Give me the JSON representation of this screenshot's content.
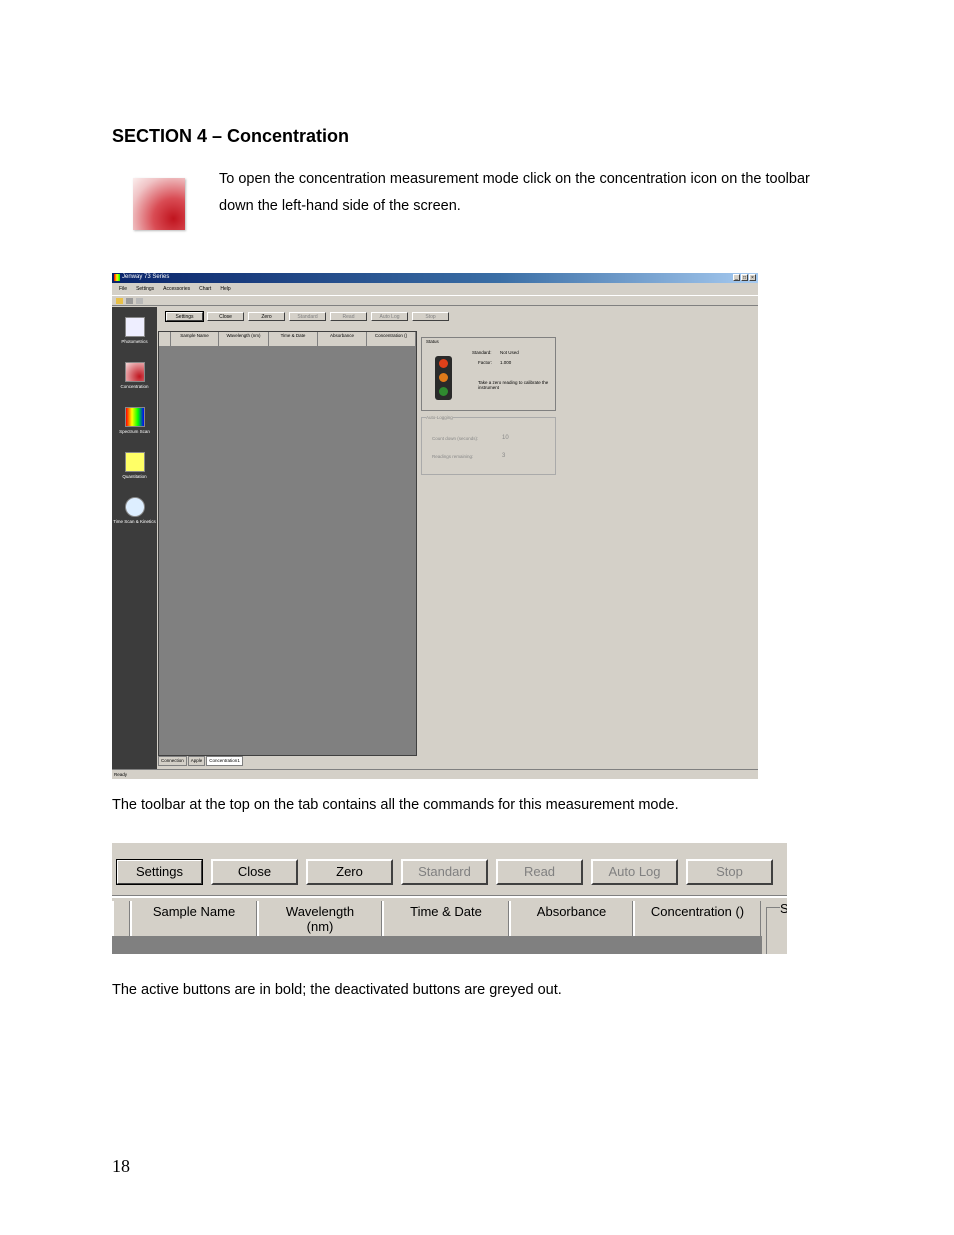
{
  "section_title": "SECTION 4 – Concentration",
  "intro_text": "To open the concentration measurement mode click on the concentration icon on the toolbar down the left-hand side of the screen.",
  "toolbar_caption": "The toolbar at the top on the tab contains all the commands for this measurement mode.",
  "active_caption": "The active buttons are in bold; the deactivated buttons are greyed out.",
  "page_number": "18",
  "app": {
    "window_title": "Jenway 73 Series",
    "menu": [
      "File",
      "Settings",
      "Accessories",
      "Chart",
      "Help"
    ],
    "window_buttons": [
      "_",
      "□",
      "×"
    ],
    "sidebar": [
      {
        "label": "Photometrics",
        "icon": "clipboard-icon"
      },
      {
        "label": "Concentration",
        "icon": "concentration-icon"
      },
      {
        "label": "Spectrum Scan",
        "icon": "spectrum-icon"
      },
      {
        "label": "Quantitation",
        "icon": "flask-icon"
      },
      {
        "label": "Time Scan & Kinetics",
        "icon": "stopwatch-icon"
      }
    ],
    "toolbar": [
      "Settings",
      "Close",
      "Zero",
      "Standard",
      "Read",
      "Auto Log",
      "Stop"
    ],
    "columns": [
      "Sample Name",
      "Wavelength (nm)",
      "Time & Date",
      "Absorbance",
      "Concentration ()"
    ],
    "status": {
      "label": "Status",
      "standard_label": "Standard:",
      "standard_value": "Not Used",
      "factor_label": "Factor:",
      "factor_value": "1.000",
      "message": "Take a zero reading to calibrate the instrument"
    },
    "autolog": {
      "label": "Auto-Logging",
      "countdown_label": "Count down (seconds):",
      "countdown_value": "10",
      "readings_label": "Readings remaining:",
      "readings_value": "3"
    },
    "tabs": [
      "Connection",
      "Apple",
      "Concentration1"
    ],
    "status_bar": "Ready"
  },
  "zoom": {
    "buttons": [
      {
        "label": "Settings",
        "state": "active"
      },
      {
        "label": "Close",
        "state": "enabled"
      },
      {
        "label": "Zero",
        "state": "enabled"
      },
      {
        "label": "Standard",
        "state": "disabled"
      },
      {
        "label": "Read",
        "state": "disabled"
      },
      {
        "label": "Auto Log",
        "state": "disabled"
      },
      {
        "label": "Stop",
        "state": "disabled"
      }
    ],
    "columns": [
      "Sample Name",
      "Wavelength\n(nm)",
      "Time & Date",
      "Absorbance",
      "Concentration ()"
    ],
    "status_fragment": "S"
  },
  "colors": {
    "window_bg": "#d4d0c8",
    "sidebar_bg": "#3c3c3c",
    "grid_bg": "#808080",
    "titlebar": "#0a246a"
  }
}
